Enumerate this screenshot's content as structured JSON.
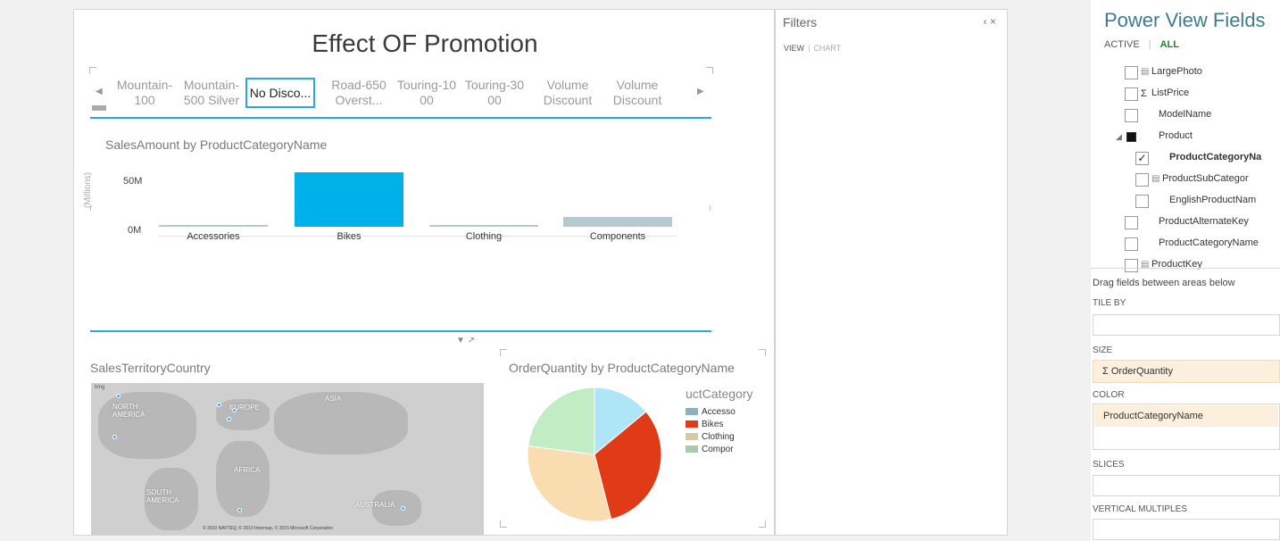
{
  "canvas": {
    "title": "Effect OF Promotion",
    "tiles": [
      "Mountain-100",
      "Mountain-500 Silver",
      "No Disco...",
      "Road-650 Overst...",
      "Touring-1000",
      "Touring-3000",
      "Volume Discount",
      "Volume Discount"
    ],
    "tile_display": [
      [
        "Mountain-",
        "100"
      ],
      [
        "Mountain-",
        "500 Silver"
      ],
      [
        "No Disco..."
      ],
      [
        "Road-650",
        "Overst..."
      ],
      [
        "Touring-10",
        "00"
      ],
      [
        "Touring-30",
        "00"
      ],
      [
        "Volume",
        "Discount"
      ],
      [
        "Volume",
        "Discount"
      ]
    ],
    "selected_tile_index": 2,
    "filter_icons": "▼ ↗"
  },
  "chart_data": [
    {
      "type": "bar",
      "title": "SalesAmount by ProductCategoryName",
      "ylabel": "(Millions)",
      "categories": [
        "Accessories",
        "Bikes",
        "Clothing",
        "Components"
      ],
      "values": [
        0.7,
        66,
        0.3,
        12
      ],
      "yticks": [
        "0M",
        "50M"
      ],
      "ylim": [
        0,
        70
      ],
      "colors": [
        "#b7c9cf",
        "#00b0e8",
        "#b7c9cf",
        "#b7c9cf"
      ]
    },
    {
      "type": "pie",
      "title": "OrderQuantity by ProductCategoryName",
      "legend_title": "uctCategory",
      "categories": [
        "Accessories",
        "Bikes",
        "Clothing",
        "Components"
      ],
      "legend_labels": [
        "Accesso",
        "Bikes",
        "Clothing",
        "Compor"
      ],
      "values": [
        14,
        32,
        31,
        23
      ],
      "colors": [
        "#aee6f7",
        "#e03a17",
        "#f9ddb1",
        "#c2ecc4"
      ],
      "legend_colors": [
        "#8fb1bb",
        "#e03a17",
        "#d8c9a4",
        "#a9cba9"
      ]
    }
  ],
  "map": {
    "title": "SalesTerritoryCountry",
    "labels": [
      "NORTH AMERICA",
      "EUROPE",
      "ASIA",
      "AFRICA",
      "SOUTH AMERICA",
      "AUSTRALIA"
    ],
    "credit": "© 2010 NAVTEQ, © 2010 Intermap, © 2015 Microsoft Corporation",
    "bing": "bing"
  },
  "filters": {
    "title": "Filters",
    "tab_view": "VIEW",
    "tab_chart": "CHART",
    "controls": "‹ ×"
  },
  "fields_panel": {
    "title": "Power View Fields",
    "tab_active": "ACTIVE",
    "tab_all": "ALL",
    "fields": [
      {
        "label": "LargePhoto",
        "icon": "▤",
        "checked": false
      },
      {
        "label": "ListPrice",
        "icon": "Σ",
        "checked": false
      },
      {
        "label": "ModelName",
        "icon": "",
        "checked": false
      },
      {
        "label": "Product",
        "icon": "",
        "checked": false,
        "expanded": true
      },
      {
        "label": "ProductCategoryNa",
        "icon": "",
        "checked": true
      },
      {
        "label": "ProductSubCategor",
        "icon": "▤",
        "checked": false
      },
      {
        "label": "EnglishProductNam",
        "icon": "",
        "checked": false
      },
      {
        "label": "ProductAlternateKey",
        "icon": "",
        "checked": false
      },
      {
        "label": "ProductCategoryName",
        "icon": "",
        "checked": false
      },
      {
        "label": "ProductKey",
        "icon": "▤",
        "checked": false
      }
    ],
    "drag_text": "Drag fields between areas below",
    "areas": {
      "tile_by": {
        "label": "TILE BY",
        "value": ""
      },
      "size": {
        "label": "SIZE",
        "value": "Σ OrderQuantity"
      },
      "color": {
        "label": "COLOR",
        "value": "ProductCategoryName"
      },
      "slices": {
        "label": "SLICES",
        "value": ""
      },
      "vertical_multiples": {
        "label": "VERTICAL MULTIPLES",
        "value": ""
      }
    }
  }
}
